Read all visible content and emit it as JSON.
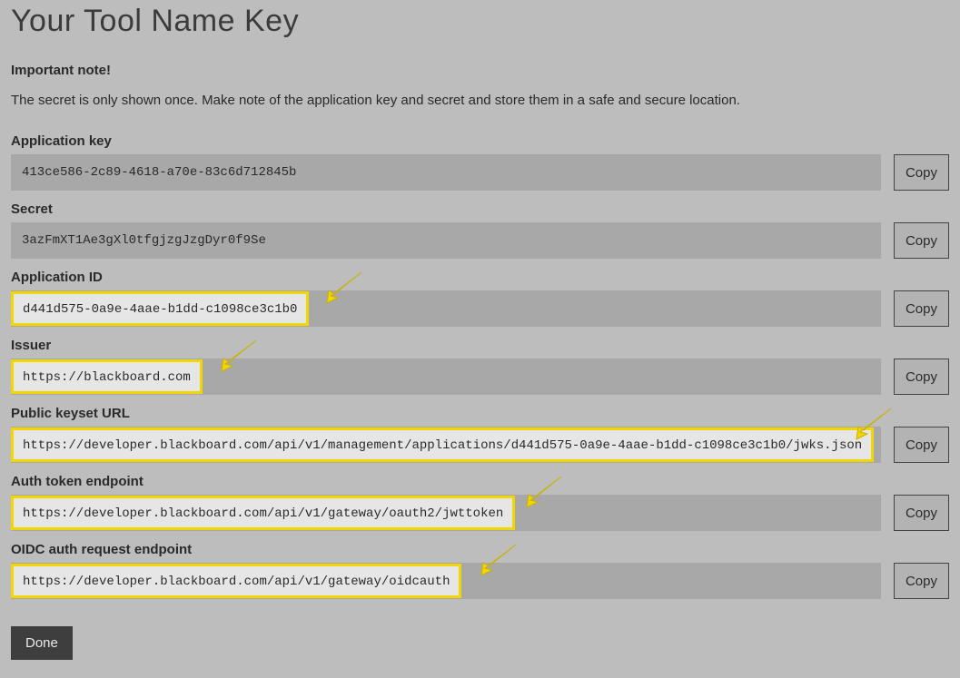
{
  "title": "Your Tool Name Key",
  "important_label": "Important note!",
  "secret_note_text": "The secret is only shown once. Make note of the application key and secret and store them in a safe and secure location.",
  "copy_label": "Copy",
  "done_label": "Done",
  "fields": {
    "app_key": {
      "label": "Application key",
      "value": "413ce586-2c89-4618-a70e-83c6d712845b"
    },
    "secret": {
      "label": "Secret",
      "value": "3azFmXT1Ae3gXl0tfgjzgJzgDyr0f9Se"
    },
    "app_id": {
      "label": "Application ID",
      "value": "d441d575-0a9e-4aae-b1dd-c1098ce3c1b0"
    },
    "issuer": {
      "label": "Issuer",
      "value": "https://blackboard.com"
    },
    "public_keyset": {
      "label": "Public keyset URL",
      "value": "https://developer.blackboard.com/api/v1/management/applications/d441d575-0a9e-4aae-b1dd-c1098ce3c1b0/jwks.json"
    },
    "auth_token": {
      "label": "Auth token endpoint",
      "value": "https://developer.blackboard.com/api/v1/gateway/oauth2/jwttoken"
    },
    "oidc_auth": {
      "label": "OIDC auth request endpoint",
      "value": "https://developer.blackboard.com/api/v1/gateway/oidcauth"
    }
  }
}
